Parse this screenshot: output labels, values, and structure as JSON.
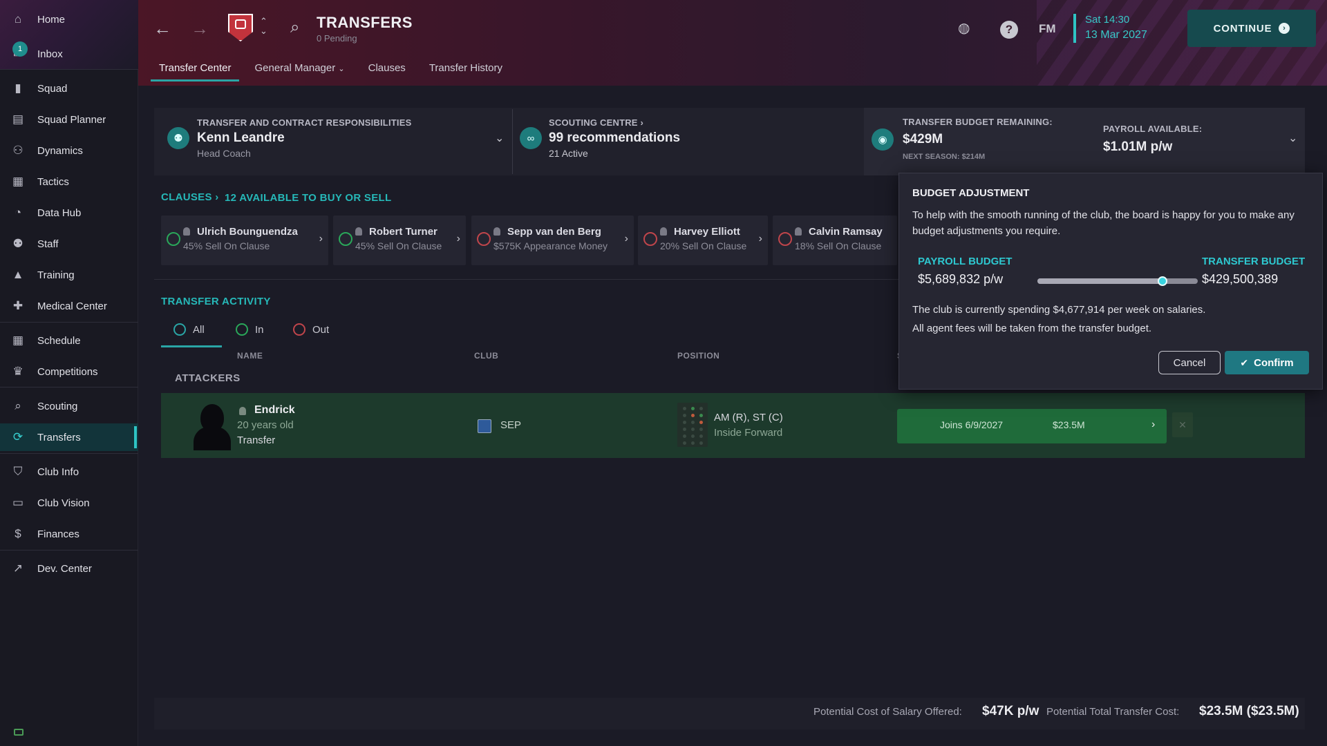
{
  "sidebar": {
    "items": [
      {
        "label": "Home",
        "icon": "home-icon",
        "glyph": "⌂"
      },
      {
        "label": "Inbox",
        "icon": "inbox-icon",
        "glyph": "✉",
        "badge": "1"
      },
      {
        "label": "Squad",
        "icon": "shirt-icon",
        "glyph": "▮"
      },
      {
        "label": "Squad Planner",
        "icon": "clipboard-icon",
        "glyph": "▤"
      },
      {
        "label": "Dynamics",
        "icon": "people-icon",
        "glyph": "⚇"
      },
      {
        "label": "Tactics",
        "icon": "tactics-board-icon",
        "glyph": "▦"
      },
      {
        "label": "Data Hub",
        "icon": "pie-chart-icon",
        "glyph": "◔"
      },
      {
        "label": "Staff",
        "icon": "staff-icon",
        "glyph": "⚉"
      },
      {
        "label": "Training",
        "icon": "cone-icon",
        "glyph": "▲"
      },
      {
        "label": "Medical Center",
        "icon": "medical-bag-icon",
        "glyph": "✚"
      },
      {
        "label": "Schedule",
        "icon": "calendar-icon",
        "glyph": "▦"
      },
      {
        "label": "Competitions",
        "icon": "trophy-icon",
        "glyph": "♛"
      },
      {
        "label": "Scouting",
        "icon": "magnifier-icon",
        "glyph": "⌕"
      },
      {
        "label": "Transfers",
        "icon": "transfer-arrows-icon",
        "glyph": "⟳"
      },
      {
        "label": "Club Info",
        "icon": "shield-icon",
        "glyph": "⛉"
      },
      {
        "label": "Club Vision",
        "icon": "briefcase-icon",
        "glyph": "▭"
      },
      {
        "label": "Finances",
        "icon": "money-icon",
        "glyph": "$"
      },
      {
        "label": "Dev. Center",
        "icon": "growth-icon",
        "glyph": "↗"
      }
    ]
  },
  "header": {
    "title": "TRANSFERS",
    "subtitle": "0 Pending",
    "tabs": [
      "Transfer Center",
      "General Manager",
      "Clauses",
      "Transfer History"
    ],
    "date_time": "Sat 14:30",
    "date_day": "13 Mar 2027",
    "fm_label": "FM",
    "help_label": "?",
    "continue_label": "CONTINUE"
  },
  "responsibilities": {
    "label": "TRANSFER AND CONTRACT RESPONSIBILITIES",
    "name": "Kenn Leandre",
    "role": "Head Coach"
  },
  "scouting": {
    "label": "SCOUTING CENTRE",
    "recommendations": "99 recommendations",
    "active": "21 Active"
  },
  "budget": {
    "remaining_label": "TRANSFER BUDGET REMAINING:",
    "remaining_value": "$429M",
    "next_season": "NEXT SEASON: $214M",
    "payroll_label": "PAYROLL AVAILABLE:",
    "payroll_value": "$1.01M p/w"
  },
  "clauses": {
    "title": "CLAUSES",
    "subtitle": "12 AVAILABLE TO BUY OR SELL",
    "cards": [
      {
        "name": "Ulrich Bounguendza",
        "desc": "45% Sell On Clause",
        "dir": "in"
      },
      {
        "name": "Robert Turner",
        "desc": "45% Sell On Clause",
        "dir": "in"
      },
      {
        "name": "Sepp van den Berg",
        "desc": "$575K Appearance Money",
        "dir": "out"
      },
      {
        "name": "Harvey Elliott",
        "desc": "20% Sell On Clause",
        "dir": "out"
      },
      {
        "name": "Calvin Ramsay",
        "desc": "18% Sell On Clause",
        "dir": "out"
      }
    ]
  },
  "activity": {
    "title": "TRANSFER ACTIVITY",
    "filters": [
      "All",
      "In",
      "Out"
    ],
    "columns": [
      "NAME",
      "CLUB",
      "POSITION",
      "S"
    ],
    "group": "ATTACKERS",
    "row": {
      "name": "Endrick",
      "age": "20 years old",
      "type": "Transfer",
      "club": "SEP",
      "position": "AM (R), ST (C)",
      "role": "Inside Forward",
      "joins": "Joins 6/9/2027",
      "fee": "$23.5M",
      "close": "✕"
    }
  },
  "footer": {
    "salary_label": "Potential Cost of Salary Offered:",
    "salary_value": "$47K p/w",
    "transfer_label": "Potential Total Transfer Cost:",
    "transfer_value": "$23.5M ($23.5M)"
  },
  "budget_adjustment": {
    "title": "BUDGET ADJUSTMENT",
    "description": "To help with the smooth running of the club, the board is happy for you to make any budget adjustments you require.",
    "payroll_label": "PAYROLL BUDGET",
    "payroll_value": "$5,689,832 p/w",
    "transfer_label": "TRANSFER BUDGET",
    "transfer_value": "$429,500,389",
    "slider_fraction": 0.78,
    "spending_note": "The club is currently spending $4,677,914 per week on salaries.",
    "agent_note": "All agent fees will be taken from the transfer budget.",
    "cancel_label": "Cancel",
    "confirm_label": "Confirm"
  },
  "colors": {
    "accent": "#2ec4c4",
    "header_maroon": "#4b1626",
    "row_green": "#1d3a2c",
    "confirm": "#1f7882"
  }
}
